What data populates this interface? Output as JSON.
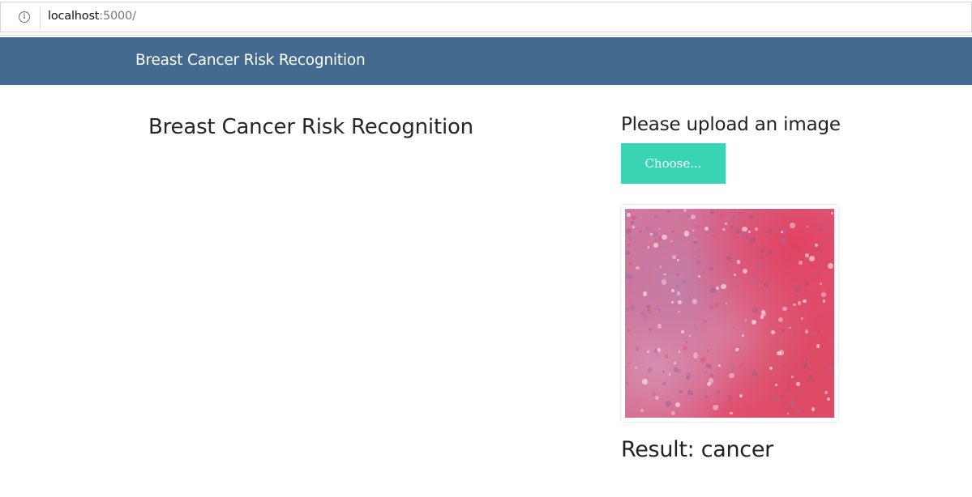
{
  "browser": {
    "url_host": "localhost",
    "url_path": ":5000/",
    "info_icon": "info-icon"
  },
  "navbar": {
    "brand": "Breast Cancer Risk Recognition",
    "background": "#436a8f"
  },
  "main": {
    "title": "Breast Cancer Risk Recognition"
  },
  "upload": {
    "heading": "Please upload an image",
    "choose_label": "Choose...",
    "button_color": "#39d4b4"
  },
  "preview": {
    "description_icon": "histology-image"
  },
  "result": {
    "text": "Result: cancer"
  }
}
